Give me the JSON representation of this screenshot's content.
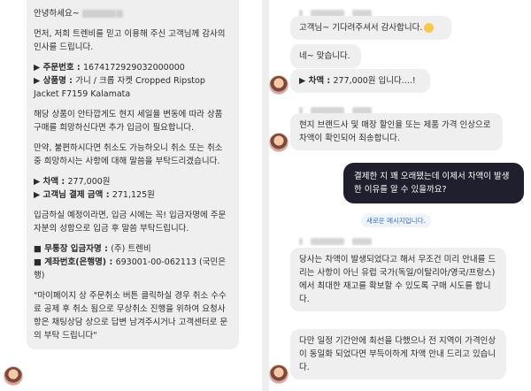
{
  "left": {
    "greeting": "안녕하세요~",
    "intro": "먼저, 저희 트렌비를 믿고 이용해 주신 고객님께 감사의 인사를 드립니다.",
    "order_no_label": "▶ 주문번호 : ",
    "order_no": "1674172929032000000",
    "product_label": "▶ 상품명 : ",
    "product": "가니 / 크롭 자켓 Cropped Ripstop Jacket F7159 Kalamata",
    "explain": "해당 상품이 안타깝게도 현지 세일율 변동에 따라 상품 구매를 희망하신다면 추가 입금이 필요합니다.",
    "cancel_note": "만약, 불편하시다면 취소도 가능하오니 취소 또는 취소 중 희망하시는 사항에 대해 말씀을 부탁드리겠습니다.",
    "diff_label": "▶ 차액 : ",
    "diff_value": "277,000원",
    "paid_label": "▶ 고객님 결제 금액 : ",
    "paid_value": "271,125원",
    "deposit_note": "입금하실 예정이라면, 입금 시에는 꼭! 입금자명에 주문자분의 성함으로 입금 후 말씀 부탁드립니다.",
    "bank_name_label": "■ 무통장 입금자명 : ",
    "bank_name": "(주) 트렌비",
    "account_label": "■ 계좌번호(은행명) : ",
    "account": "693001-00-062113 (국민은행)",
    "mypage_note": "\"마이페이지 상 주문취소 버튼 클릭하실 경우 취소 수수료 공제 후 취소 됨으로 무상취소 진행을 위하여 요청사항은 채팅상담 상으로 답변 남겨주시거나 고객센터로 문의 부탁 드립니다\""
  },
  "right": {
    "msg1": "고객님~ 기다려주셔서 감사합니다.",
    "msg2": "네~ 맞습니다.",
    "msg3_label": "▶ 차액 : ",
    "msg3_value": "277,000원 입니다....!",
    "msg4": "현지 브랜드사 및 매장 할인율 또는 제품 가격 인상으로 차액이 확인되어 죄송합니다.",
    "my_msg": "결제한 지 꽤 오래됐는데 이제서 차액이 발생한 이유를 알 수 있을까요?",
    "new_messages": "새로운 메시지입니다.",
    "msg5": "당사는 차액이 발생되었다고 해서 무조건 미리 안내를 드리는 사항이 아닌 유럽 국가(독일/이탈리아/영국/프랑스)에서 최대한 재고를 확보할 수 있도록 구매 시도를 합니다.",
    "msg6": "다만 일정 기간안에 최선을 다했으나 전 지역이 가격인상이 동일화 되었다면 부득이하게 차액 안내 드리고 있습니다."
  },
  "colors": {
    "incoming_bubble": "#efefef",
    "outgoing_bubble": "#1f1f2e",
    "new_message_text": "#3b6fd4"
  }
}
